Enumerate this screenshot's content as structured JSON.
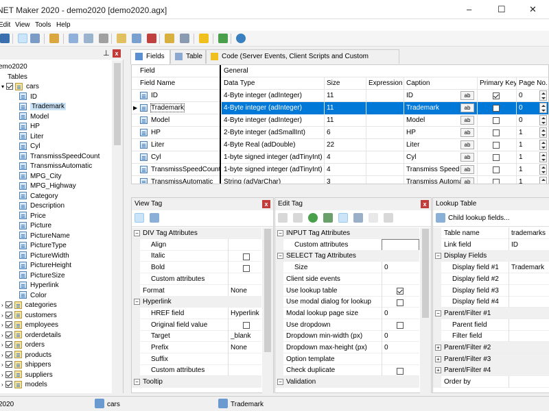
{
  "window": {
    "title": "NET Maker 2020 - demo2020 [demo2020.agx]",
    "minimize": "–",
    "maximize": "☐",
    "close": "✕"
  },
  "menu": [
    "Edit",
    "View",
    "Tools",
    "Help"
  ],
  "tree": {
    "root": "emo2020",
    "tables": "Tables",
    "cars": "cars",
    "fields": [
      "ID",
      "Trademark",
      "Model",
      "HP",
      "Liter",
      "Cyl",
      "TransmissSpeedCount",
      "TransmissAutomatic",
      "MPG_City",
      "MPG_Highway",
      "Category",
      "Description",
      "Price",
      "Picture",
      "PictureName",
      "PictureType",
      "PictureWidth",
      "PictureHeight",
      "PictureSize",
      "Hyperlink",
      "Color"
    ],
    "others": [
      "categories",
      "customers",
      "employees",
      "orderdetails",
      "orders",
      "products",
      "shippers",
      "suppliers",
      "models"
    ]
  },
  "tabs": [
    "Fields",
    "Table",
    "Code (Server Events, Client Scripts and Custom Templates)"
  ],
  "grid": {
    "header_top": [
      "Field",
      "General"
    ],
    "headers": [
      "Field Name",
      "Data Type",
      "Size",
      "Expression",
      "Caption",
      "Primary Key",
      "Page No."
    ],
    "rows": [
      {
        "name": "ID",
        "type": "4-Byte integer (adInteger)",
        "size": "11",
        "caption": "ID",
        "pk": true,
        "page": "0"
      },
      {
        "name": "Trademark",
        "type": "4-Byte integer (adInteger)",
        "size": "11",
        "caption": "Trademark",
        "pk": false,
        "page": "0"
      },
      {
        "name": "Model",
        "type": "4-Byte integer (adInteger)",
        "size": "11",
        "caption": "Model",
        "pk": false,
        "page": "0"
      },
      {
        "name": "HP",
        "type": "2-Byte integer (adSmallInt)",
        "size": "6",
        "caption": "HP",
        "pk": false,
        "page": "1"
      },
      {
        "name": "Liter",
        "type": "4-Byte Real (adDouble)",
        "size": "22",
        "caption": "Liter",
        "pk": false,
        "page": "1"
      },
      {
        "name": "Cyl",
        "type": "1-byte signed integer (adTinyInt)",
        "size": "4",
        "caption": "Cyl",
        "pk": false,
        "page": "1"
      },
      {
        "name": "TransmissSpeedCount",
        "type": "1-byte signed integer (adTinyInt)",
        "size": "4",
        "caption": "Transmiss Speed Co",
        "pk": false,
        "page": "1"
      },
      {
        "name": "TransmissAutomatic",
        "type": "String (adVarChar)",
        "size": "3",
        "caption": "Transmiss Automati",
        "pk": false,
        "page": "1"
      }
    ],
    "caption_btn": "ab"
  },
  "view_tag": {
    "title": "View Tag",
    "rows": [
      {
        "type": "cat",
        "k": "DIV Tag Attributes"
      },
      {
        "k": "Align",
        "v": ""
      },
      {
        "k": "Italic",
        "cb": false
      },
      {
        "k": "Bold",
        "cb": false
      },
      {
        "k": "Custom attributes",
        "v": ""
      },
      {
        "type": "top",
        "k": "Format",
        "v": "None"
      },
      {
        "type": "cat",
        "k": "Hyperlink"
      },
      {
        "k": "HREF field",
        "v": "Hyperlink"
      },
      {
        "k": "Original field value",
        "cb": false
      },
      {
        "k": "Target",
        "v": "_blank"
      },
      {
        "k": "Prefix",
        "v": "None"
      },
      {
        "k": "Suffix",
        "v": ""
      },
      {
        "k": "Custom attributes",
        "v": ""
      },
      {
        "type": "cat",
        "k": "Tooltip"
      }
    ]
  },
  "edit_tag": {
    "title": "Edit Tag",
    "rows": [
      {
        "type": "cat",
        "k": "INPUT Tag Attributes"
      },
      {
        "k": "Custom attributes",
        "v": ""
      },
      {
        "type": "cat",
        "k": "SELECT Tag Attributes"
      },
      {
        "k": "Size",
        "v": "0"
      },
      {
        "type": "top",
        "k": "Client side events",
        "v": ""
      },
      {
        "type": "top",
        "k": "Use lookup table",
        "cb": true
      },
      {
        "type": "top",
        "k": "Use modal dialog for lookup",
        "cb": false
      },
      {
        "type": "top",
        "k": "Modal lookup page size",
        "v": "0"
      },
      {
        "type": "top",
        "k": "Use dropdown",
        "cb": false
      },
      {
        "type": "top",
        "k": "Dropdown min-width (px)",
        "v": "0"
      },
      {
        "type": "top",
        "k": "Dropdown max-height (px)",
        "v": "0"
      },
      {
        "type": "top",
        "k": "Option template",
        "v": ""
      },
      {
        "type": "top",
        "k": "Check duplicate",
        "cb": false
      },
      {
        "type": "cat",
        "k": "Validation"
      }
    ]
  },
  "lookup": {
    "title": "Lookup Table",
    "child_btn": "Child lookup fields...",
    "rows": [
      {
        "type": "top",
        "k": "Table name",
        "v": "trademarks"
      },
      {
        "type": "top",
        "k": "Link field",
        "v": "ID"
      },
      {
        "type": "cat",
        "k": "Display Fields",
        "sign": "−"
      },
      {
        "k": "Display field #1",
        "v": "Trademark"
      },
      {
        "k": "Display field #2",
        "v": ""
      },
      {
        "k": "Display field #3",
        "v": ""
      },
      {
        "k": "Display field #4",
        "v": ""
      },
      {
        "type": "cat",
        "k": "Parent/Filter #1",
        "sign": "−"
      },
      {
        "k": "Parent field",
        "v": ""
      },
      {
        "k": "Filter field",
        "v": ""
      },
      {
        "type": "cat",
        "k": "Parent/Filter #2",
        "sign": "+"
      },
      {
        "type": "cat",
        "k": "Parent/Filter #3",
        "sign": "+"
      },
      {
        "type": "cat",
        "k": "Parent/Filter #4",
        "sign": "+"
      },
      {
        "type": "top",
        "k": "Order by",
        "v": ""
      }
    ]
  },
  "status": {
    "left": "2020",
    "table": "cars",
    "field": "Trademark"
  }
}
